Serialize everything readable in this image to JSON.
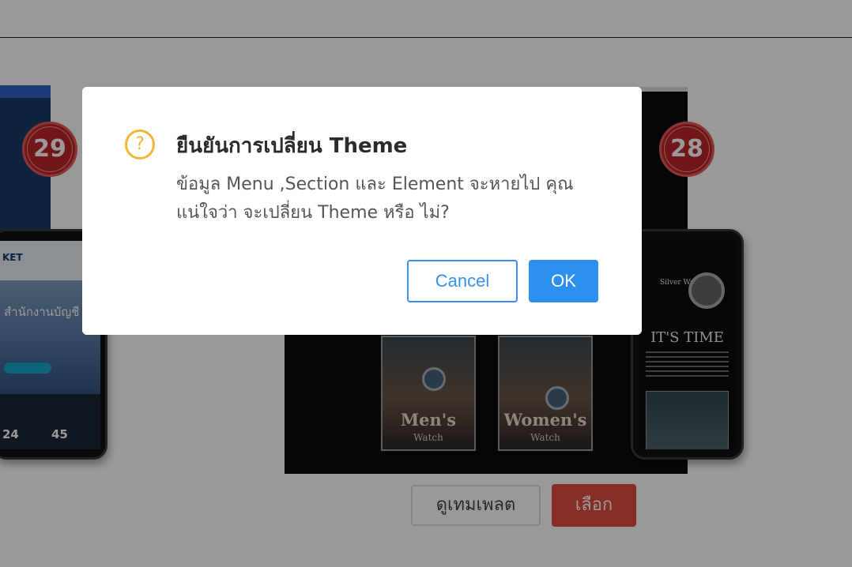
{
  "gallery": {
    "left_template": {
      "badge": "29",
      "phone_logo": "KET",
      "hero_title": "สำนักงานบัญชี",
      "stat_1": "24",
      "stat_2": "45"
    },
    "center_template": {
      "badge": "28",
      "card_1_title": "Men's",
      "card_1_sub": "Watch",
      "card_2_title": "Women's",
      "card_2_sub": "Watch",
      "phone_brand": "Silver Watch",
      "phone_headline": "IT'S TIME"
    },
    "preview_button": "ดูเทมเพลต",
    "select_button": "เลือก",
    "colors": {
      "select_button": "#e24c3c",
      "badge": "#c0262a"
    }
  },
  "dialog": {
    "icon": "question-circle-icon",
    "icon_glyph": "?",
    "title": "ยืนยันการเปลี่ยน Theme",
    "message": "ข้อมูล Menu ,Section และ Element จะหายไป คุณแน่ใจว่า จะเปลี่ยน Theme หรือ ไม่?",
    "cancel_label": "Cancel",
    "ok_label": "OK",
    "colors": {
      "icon": "#f3b632",
      "primary": "#2d8ff0"
    }
  }
}
